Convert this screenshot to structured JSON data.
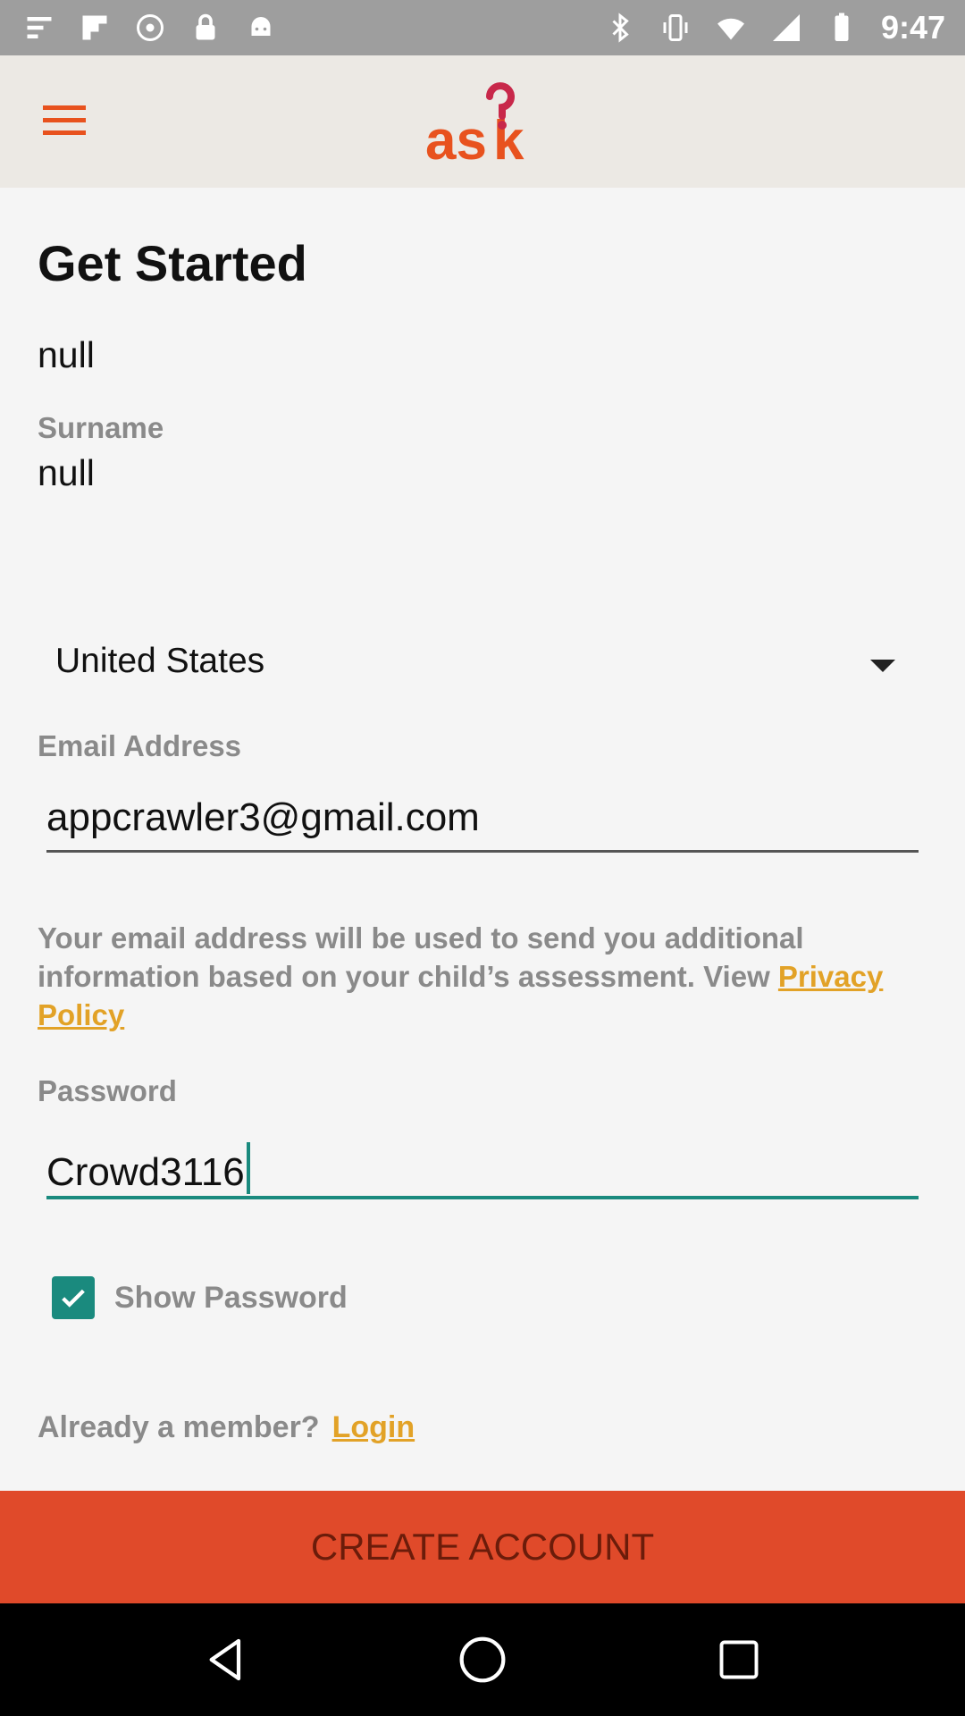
{
  "status_bar": {
    "time": "9:47",
    "left_icons": [
      "menu-lines-icon",
      "flipboard-icon",
      "sync-icon",
      "lock-icon",
      "android-icon"
    ],
    "right_icons": [
      "bluetooth-icon",
      "vibrate-icon",
      "wifi-icon",
      "signal-icon",
      "battery-icon"
    ]
  },
  "app_bar": {
    "menu_icon": "hamburger-menu-icon",
    "logo_text": "ask",
    "accent": "#e8521e"
  },
  "form": {
    "title": "Get Started",
    "first_name_value": "null",
    "surname_label": "Surname",
    "surname_value": "null",
    "country_value": "United States",
    "email_label": "Email Address",
    "email_value": "appcrawler3@gmail.com",
    "info_text": "Your email address will be used to send you additional information based on your child’s assessment. View ",
    "privacy_link": "Privacy Policy",
    "password_label": "Password",
    "password_value": "Crowd3116",
    "show_password_label": "Show Password",
    "show_password_checked": true,
    "member_text": "Already a member?",
    "login_link": "Login",
    "create_button": "CREATE ACCOUNT"
  },
  "nav_bar": {
    "buttons": [
      "back-icon",
      "home-icon",
      "recents-icon"
    ]
  },
  "colors": {
    "accent_teal": "#1a8a7e",
    "link_gold": "#e2a227",
    "button_red": "#e04a2a",
    "label_gray": "#8a8a8a"
  }
}
